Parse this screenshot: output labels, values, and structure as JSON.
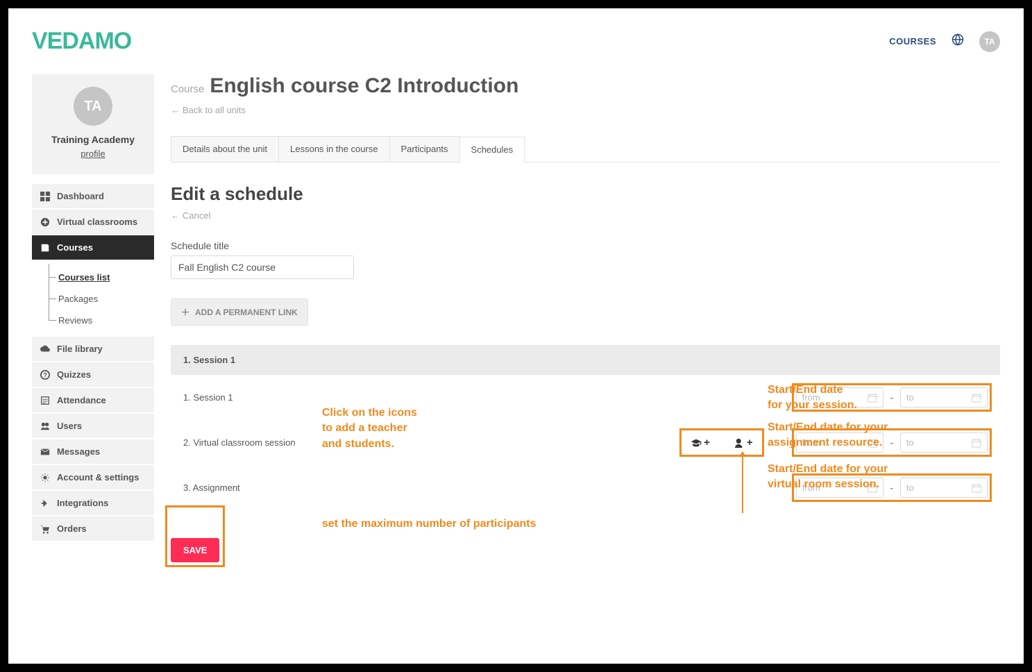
{
  "brand": "VEDAMO",
  "top_nav": {
    "courses": "COURSES",
    "avatar": "TA"
  },
  "profile": {
    "avatar": "TA",
    "name": "Training Academy",
    "link": "profile"
  },
  "sidebar": {
    "items": [
      {
        "label": "Dashboard"
      },
      {
        "label": "Virtual classrooms"
      },
      {
        "label": "Courses",
        "active": true
      },
      {
        "label": "File library"
      },
      {
        "label": "Quizzes"
      },
      {
        "label": "Attendance"
      },
      {
        "label": "Users"
      },
      {
        "label": "Messages"
      },
      {
        "label": "Account & settings"
      },
      {
        "label": "Integrations"
      },
      {
        "label": "Orders"
      }
    ],
    "sub": {
      "courses_list": "Courses list",
      "packages": "Packages",
      "reviews": "Reviews"
    }
  },
  "page": {
    "course_prefix": "Course",
    "course_title": "English course C2 Introduction",
    "back": "Back to all units"
  },
  "tabs": {
    "details": "Details about the unit",
    "lessons": "Lessons in the course",
    "participants": "Participants",
    "schedules": "Schedules"
  },
  "edit": {
    "title": "Edit a schedule",
    "cancel": "Cancel",
    "schedule_title_label": "Schedule title",
    "schedule_title_value": "Fall English C2 course",
    "perm_link": "ADD A PERMANENT LINK",
    "save": "SAVE"
  },
  "schedule": {
    "header": "1. Session 1",
    "rows": [
      {
        "label": "1. Session 1"
      },
      {
        "label": "2. Virtual classroom session"
      },
      {
        "label": "3. Assignment"
      }
    ],
    "from_ph": "from",
    "to_ph": "to"
  },
  "annotations": {
    "icons_hint_1": "Click on the icons",
    "icons_hint_2": "to add a teacher",
    "icons_hint_3": "and students.",
    "max_participants": "set the maximum number of participants",
    "date_hint_1a": "Start/End date",
    "date_hint_1b": "for your session.",
    "date_hint_2a": "Start/End date for your",
    "date_hint_2b": "assignment resource.",
    "date_hint_3a": "Start/End date for your",
    "date_hint_3b": "virtual room session."
  }
}
